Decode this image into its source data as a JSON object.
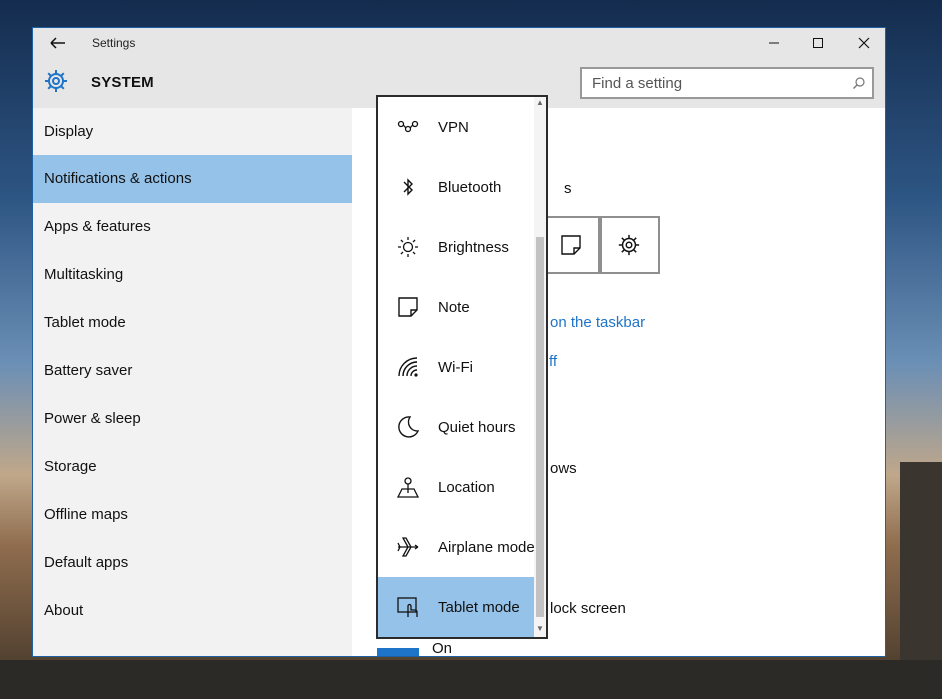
{
  "window": {
    "title": "Settings",
    "app_section": "SYSTEM",
    "search_placeholder": "Find a setting",
    "accent_color": "#1e74c8",
    "selection_color": "#95c2e8"
  },
  "sidebar": {
    "selected_index": 1,
    "items": [
      {
        "label": "Display"
      },
      {
        "label": "Notifications & actions"
      },
      {
        "label": "Apps & features"
      },
      {
        "label": "Multitasking"
      },
      {
        "label": "Tablet mode"
      },
      {
        "label": "Battery saver"
      },
      {
        "label": "Power & sleep"
      },
      {
        "label": "Storage"
      },
      {
        "label": "Offline maps"
      },
      {
        "label": "Default apps"
      },
      {
        "label": "About"
      }
    ]
  },
  "content": {
    "heading_fragment": "s",
    "quick_action_icons": [
      "note-icon",
      "gear-icon"
    ],
    "link_taskbar_fragment": "on the taskbar",
    "link_off_fragment": "ff",
    "text_windows_fragment": "ows",
    "text_lock_screen_fragment": "lock screen",
    "toggle_label_fragment": "On"
  },
  "dropdown": {
    "selected_index": 8,
    "items": [
      {
        "label": "VPN",
        "icon": "vpn-icon"
      },
      {
        "label": "Bluetooth",
        "icon": "bluetooth-icon"
      },
      {
        "label": "Brightness",
        "icon": "brightness-icon"
      },
      {
        "label": "Note",
        "icon": "note-icon"
      },
      {
        "label": "Wi-Fi",
        "icon": "wifi-icon"
      },
      {
        "label": "Quiet hours",
        "icon": "moon-icon"
      },
      {
        "label": "Location",
        "icon": "location-icon"
      },
      {
        "label": "Airplane mode",
        "icon": "airplane-icon"
      },
      {
        "label": "Tablet mode",
        "icon": "tablet-mode-icon"
      }
    ]
  }
}
